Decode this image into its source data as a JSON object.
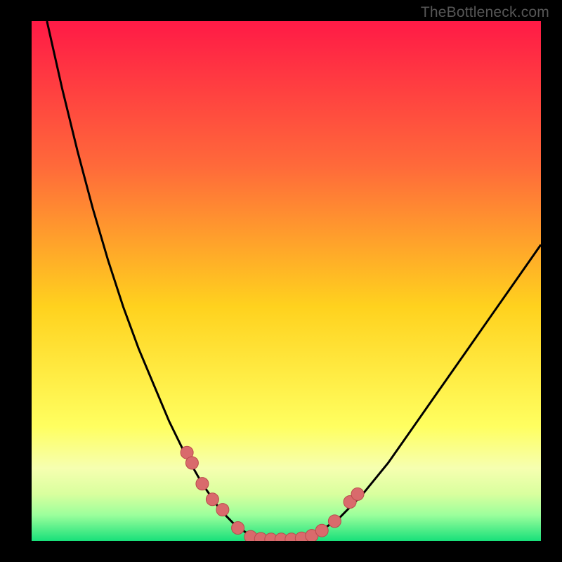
{
  "watermark": "TheBottleneck.com",
  "colors": {
    "black": "#000000",
    "curve": "#000000",
    "marker_fill": "#d96a6c",
    "marker_stroke": "#b94a4c",
    "grad_top": "#ff1a46",
    "grad_mid1": "#ff6a3a",
    "grad_mid2": "#ffd21e",
    "grad_mid3": "#ffff60",
    "grad_band1": "#f6ffb0",
    "grad_band2": "#d9ff9e",
    "grad_band3": "#9cff9c",
    "grad_bottom": "#18e07a"
  },
  "chart_data": {
    "type": "line",
    "title": "",
    "xlabel": "",
    "ylabel": "",
    "xlim": [
      0,
      100
    ],
    "ylim": [
      0,
      100
    ],
    "series": [
      {
        "name": "bottleneck-curve",
        "x": [
          3,
          6,
          9,
          12,
          15,
          18,
          21,
          24,
          27,
          30,
          33.5,
          37,
          40,
          43,
          47,
          55,
          60,
          65,
          70,
          75,
          80,
          85,
          90,
          95,
          100
        ],
        "y": [
          100,
          87,
          75,
          64,
          54,
          45,
          37,
          30,
          23,
          17,
          11,
          6,
          3,
          1,
          0,
          1,
          4,
          9,
          15,
          22,
          29,
          36,
          43,
          50,
          57
        ]
      }
    ],
    "markers": {
      "name": "highlight-points",
      "x": [
        30.5,
        31.5,
        33.5,
        35.5,
        37.5,
        40.5,
        43,
        45,
        47,
        49,
        51,
        53,
        55,
        57,
        59.5,
        62.5,
        64
      ],
      "y": [
        17,
        15,
        11,
        8,
        6,
        2.5,
        0.8,
        0.4,
        0.3,
        0.3,
        0.3,
        0.5,
        1,
        2,
        3.8,
        7.5,
        9
      ]
    }
  }
}
